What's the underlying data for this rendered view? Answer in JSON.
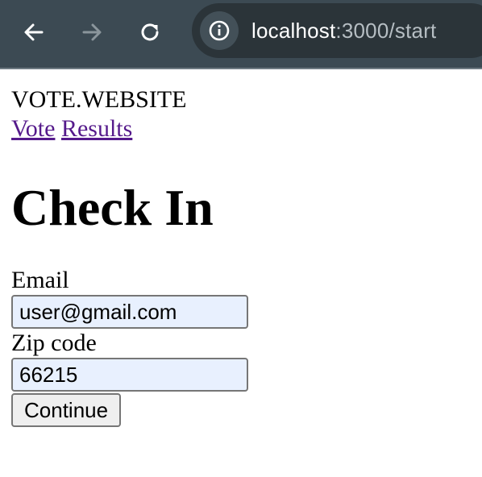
{
  "browser": {
    "url_host": "localhost",
    "url_rest": ":3000/start",
    "icons": {
      "back": "arrow-left-icon",
      "forward": "arrow-right-icon",
      "reload": "reload-icon",
      "site_info": "info-icon"
    },
    "colors": {
      "toolbar": "#3c4a53",
      "omnibox": "#2b3439"
    }
  },
  "site": {
    "brand": "VOTE.WEBSITE",
    "nav": [
      {
        "label": "Vote"
      },
      {
        "label": "Results"
      }
    ],
    "link_color": "#551a8b"
  },
  "form": {
    "title": "Check In",
    "email_label": "Email",
    "email_value": "user@gmail.com",
    "zip_label": "Zip code",
    "zip_value": "66215",
    "submit_label": "Continue",
    "autofill_color": "#e8f0fe"
  }
}
